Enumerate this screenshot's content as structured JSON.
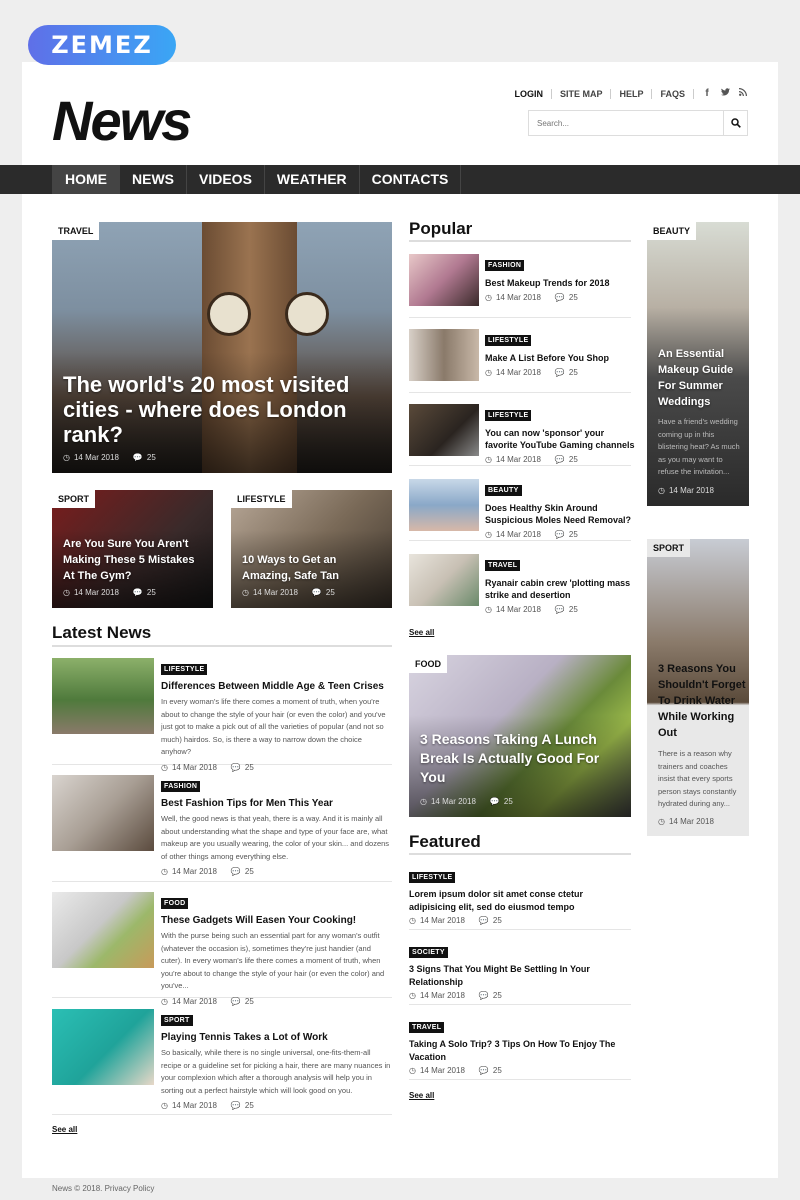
{
  "brand": {
    "badge": "ZEMEZ",
    "logo": "News"
  },
  "top_links": [
    "LOGIN",
    "SITE MAP",
    "HELP",
    "FAQS"
  ],
  "social_icons": [
    "facebook-icon",
    "twitter-icon",
    "rss-icon"
  ],
  "search": {
    "placeholder": "Search..."
  },
  "nav": [
    "HOME",
    "NEWS",
    "VIDEOS",
    "WEATHER",
    "CONTACTS"
  ],
  "hero": {
    "tag": "TRAVEL",
    "title": "The world's 20 most visited cities - where does London rank?",
    "date": "14 Mar 2018",
    "comments": "25"
  },
  "sub_features": [
    {
      "tag": "SPORT",
      "title": "Are You Sure You Aren't Making These 5 Mistakes At The Gym?",
      "date": "14 Mar 2018",
      "comments": "25"
    },
    {
      "tag": "LIFESTYLE",
      "title": "10 Ways to Get an Amazing, Safe Tan",
      "date": "14 Mar 2018",
      "comments": "25"
    }
  ],
  "latest": {
    "heading": "Latest News",
    "items": [
      {
        "tag": "LIFESTYLE",
        "title": "Differences Between Middle Age & Teen Crises",
        "desc": "In every woman's life there comes a moment of truth, when you're about to change the style of your hair (or even the color) and you've just got to make a pick out of all the varieties of popular (and not so much) hairdos. So, is there a way to narrow down the choice anyhow?",
        "date": "14 Mar 2018",
        "comments": "25"
      },
      {
        "tag": "FASHION",
        "title": "Best Fashion Tips for Men This Year",
        "desc": "Well, the good news is that yeah, there is a way. And it is mainly all about understanding what the shape and type of your face are, what makeup are you usually wearing, the color of your skin... and dozens of other things among everything else.",
        "date": "14 Mar 2018",
        "comments": "25"
      },
      {
        "tag": "FOOD",
        "title": "These Gadgets Will Easen Your Cooking!",
        "desc": "With the purse being such an essential part for any woman's outfit (whatever the occasion is), sometimes they're just handier (and cuter). In every woman's life there comes a moment of truth, when you're about to change the style of your hair (or even the color) and you've...",
        "date": "14 Mar 2018",
        "comments": "25"
      },
      {
        "tag": "SPORT",
        "title": "Playing Tennis Takes a Lot of Work",
        "desc": "So basically, while there is no single universal, one-fits-them-all recipe or a guideline set for picking a hair, there are many nuances in your complexion which after a thorough analysis will help you in sorting out a perfect hairstyle which will look good on you.",
        "date": "14 Mar 2018",
        "comments": "25"
      }
    ],
    "see_all": "See all"
  },
  "popular": {
    "heading": "Popular",
    "items": [
      {
        "tag": "FASHION",
        "title": "Best Makeup Trends for 2018",
        "date": "14 Mar 2018",
        "comments": "25"
      },
      {
        "tag": "LIFESTYLE",
        "title": "Make A List Before You Shop",
        "date": "14 Mar 2018",
        "comments": "25"
      },
      {
        "tag": "LIFESTYLE",
        "title": "You can now 'sponsor' your favorite YouTube Gaming channels",
        "date": "14 Mar 2018",
        "comments": "25"
      },
      {
        "tag": "BEAUTY",
        "title": "Does Healthy Skin Around Suspicious Moles Need Removal?",
        "date": "14 Mar 2018",
        "comments": "25"
      },
      {
        "tag": "TRAVEL",
        "title": "Ryanair cabin crew 'plotting mass strike and desertion",
        "date": "14 Mar 2018",
        "comments": "25"
      }
    ],
    "see_all": "See all"
  },
  "food_feature": {
    "tag": "FOOD",
    "title": "3 Reasons Taking A Lunch Break Is Actually Good For You",
    "date": "14 Mar 2018",
    "comments": "25"
  },
  "featured": {
    "heading": "Featured",
    "items": [
      {
        "tag": "LIFESTYLE",
        "title": "Lorem ipsum dolor sit amet conse ctetur adipisicing elit, sed do eiusmod tempo",
        "date": "14 Mar 2018",
        "comments": "25"
      },
      {
        "tag": "SOCIETY",
        "title": "3 Signs That You Might Be Settling In Your Relationship",
        "date": "14 Mar 2018",
        "comments": "25"
      },
      {
        "tag": "TRAVEL",
        "title": "Taking A Solo Trip? 3 Tips On How To Enjoy The Vacation",
        "date": "14 Mar 2018",
        "comments": "25"
      }
    ],
    "see_all": "See all"
  },
  "sidebar": [
    {
      "tag": "BEAUTY",
      "title": "An Essential Makeup Guide For Summer Weddings",
      "desc": "Have a friend's wedding coming up in this blistering heat? As much as you may want to refuse the invitation...",
      "date": "14 Mar 2018"
    },
    {
      "tag": "SPORT",
      "title": "3 Reasons You Shouldn't Forget To Drink Water While Working Out",
      "desc": "There is a reason why trainers and coaches insist that every sports person stays constantly hydrated during any...",
      "date": "14 Mar 2018"
    }
  ],
  "footer": {
    "text": "News  © 2018.  Privacy Policy"
  }
}
